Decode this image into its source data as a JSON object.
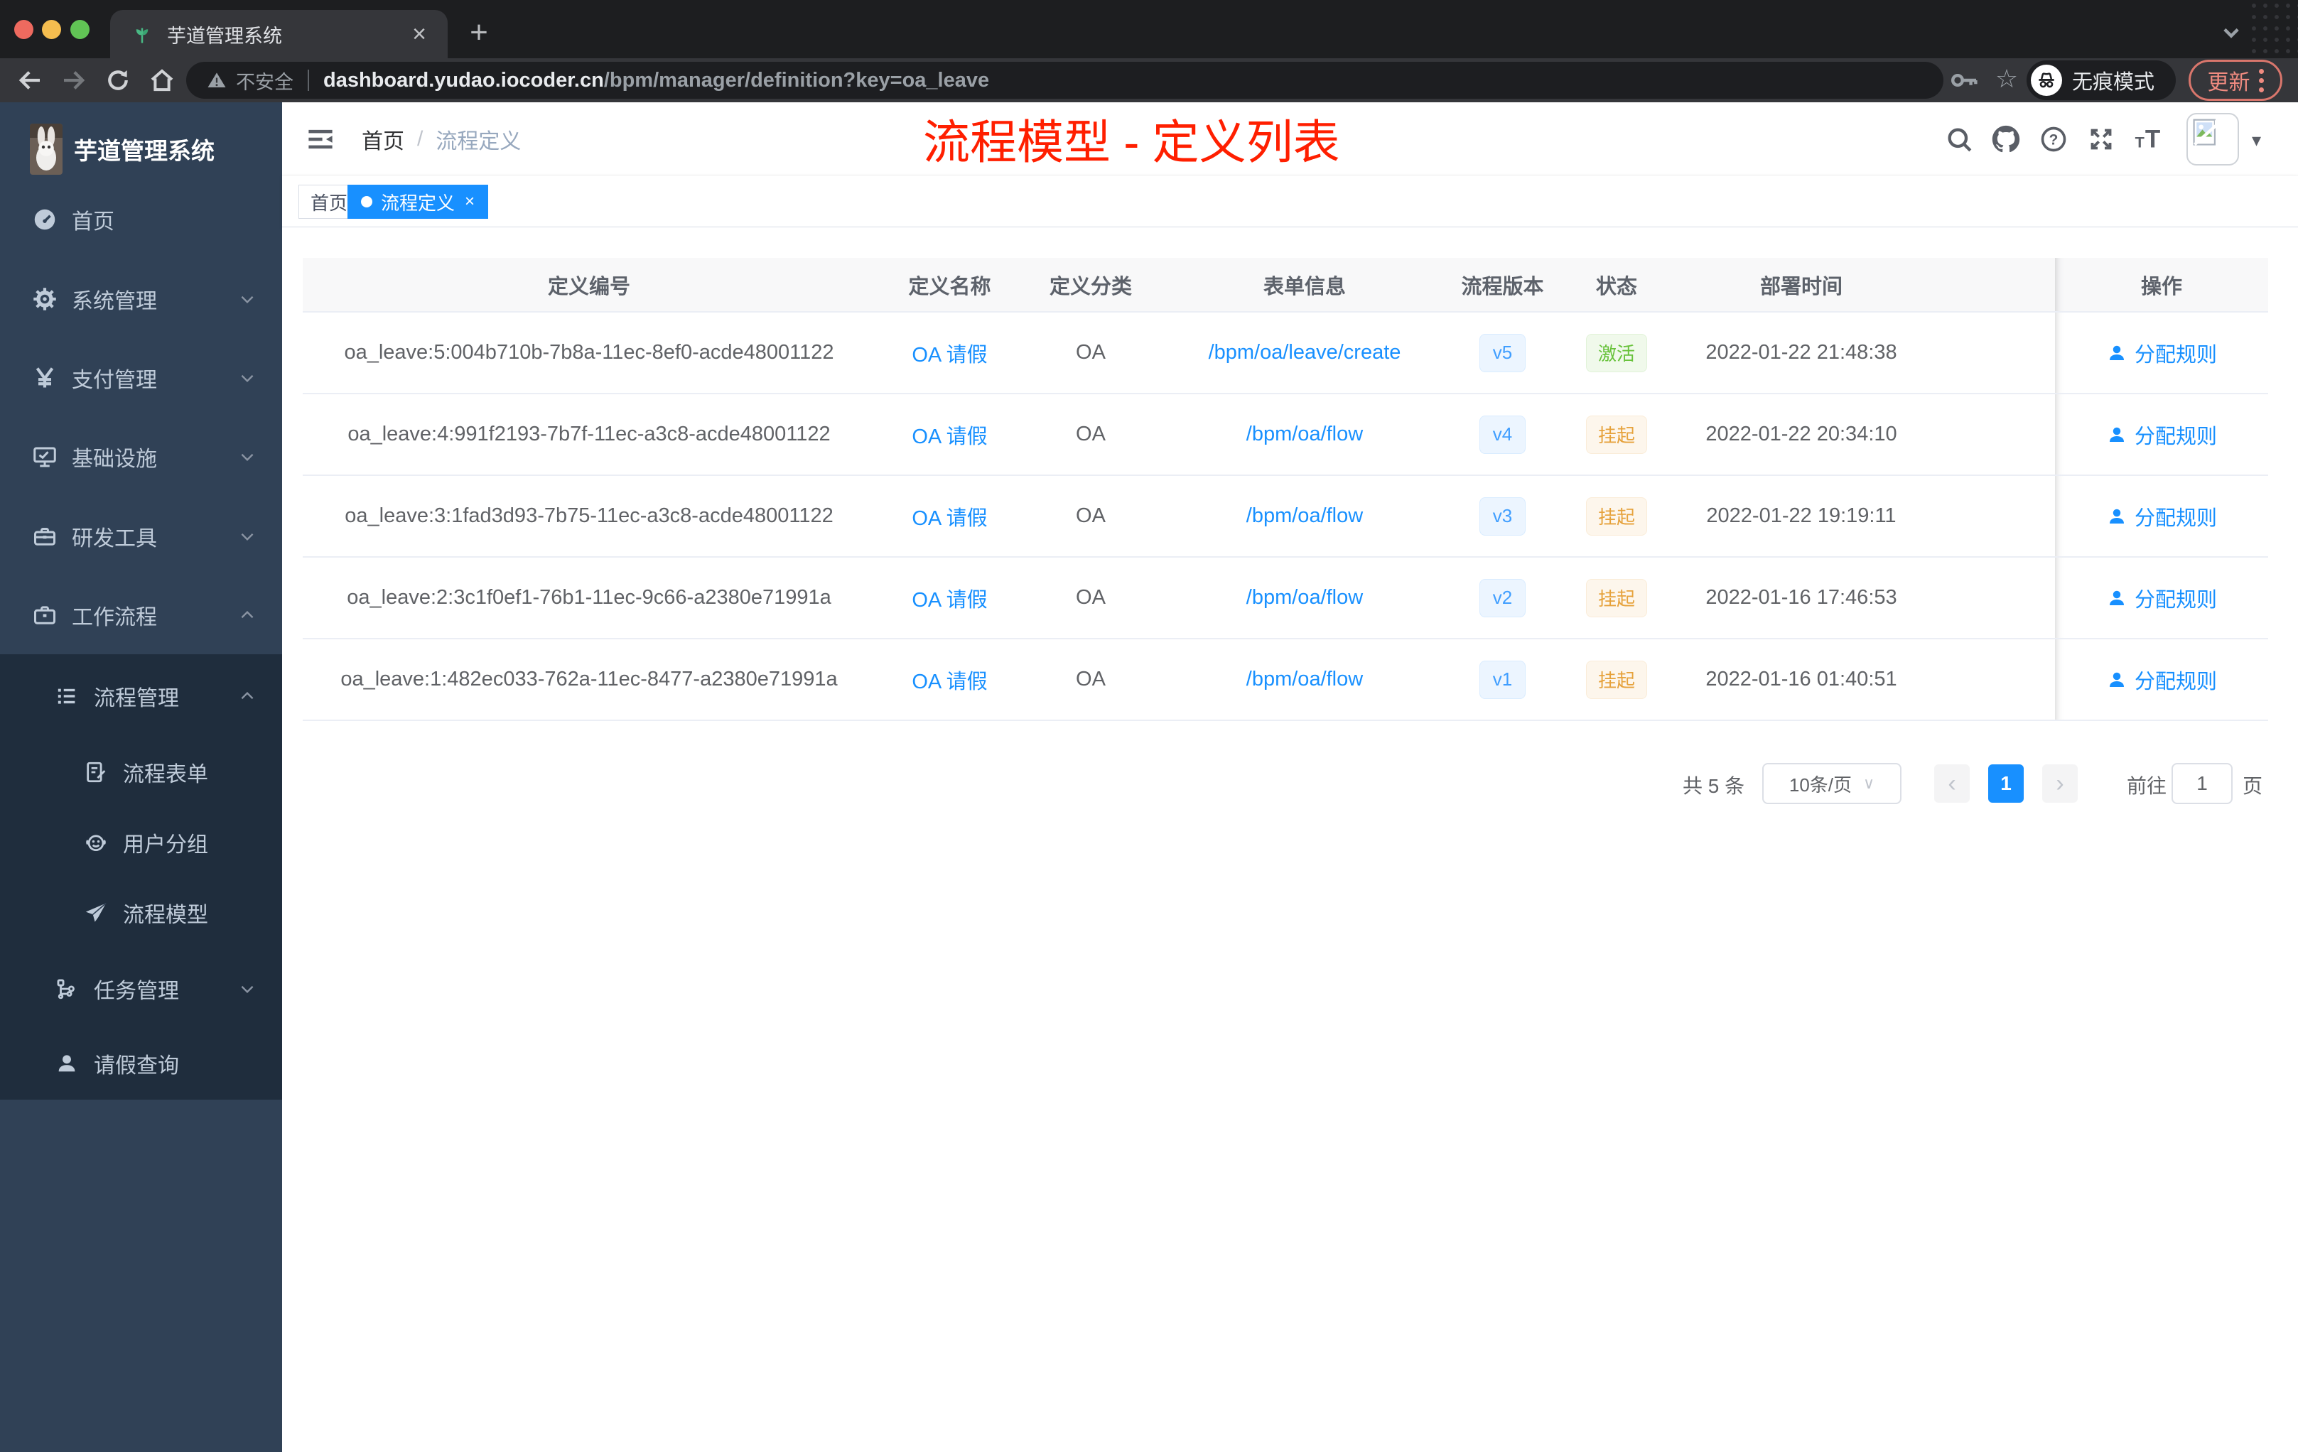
{
  "browser": {
    "tab": {
      "title": "芋道管理系统"
    },
    "address": {
      "security": "不安全",
      "domain": "dashboard.yudao.iocoder.cn",
      "path": "/bpm/manager/definition?key=oa_leave"
    },
    "incognito_label": "无痕模式",
    "update_label": "更新"
  },
  "glyphs": {
    "close": "×",
    "plus": "+",
    "slash": "/",
    "star": "☆",
    "caret_down": "▾",
    "prev": "‹",
    "next": "›",
    "select_caret": "∨"
  },
  "sidebar": {
    "logo_title": "芋道管理系统",
    "items": [
      {
        "label": "首页",
        "icon": "dashboard-icon",
        "level": 1
      },
      {
        "label": "系统管理",
        "icon": "gear-icon",
        "level": 1,
        "expanded": false
      },
      {
        "label": "支付管理",
        "icon": "yen-icon",
        "level": 1,
        "expanded": false
      },
      {
        "label": "基础设施",
        "icon": "monitor-icon",
        "level": 1,
        "expanded": false
      },
      {
        "label": "研发工具",
        "icon": "toolbox-icon",
        "level": 1,
        "expanded": false
      },
      {
        "label": "工作流程",
        "icon": "briefcase-icon",
        "level": 1,
        "expanded": true
      },
      {
        "label": "流程管理",
        "icon": "list-icon",
        "level": 2,
        "expanded": true
      },
      {
        "label": "流程表单",
        "icon": "form-icon",
        "level": 3
      },
      {
        "label": "用户分组",
        "icon": "group-icon",
        "level": 3
      },
      {
        "label": "流程模型",
        "icon": "plane-icon",
        "level": 3
      },
      {
        "label": "任务管理",
        "icon": "tasks-icon",
        "level": 2,
        "expanded": false
      },
      {
        "label": "请假查询",
        "icon": "user-icon",
        "level": 2
      }
    ]
  },
  "header": {
    "breadcrumb": [
      "首页",
      "流程定义"
    ],
    "overlay_title": "流程模型 - 定义列表"
  },
  "tags": [
    {
      "label": "首页",
      "active": false
    },
    {
      "label": "流程定义",
      "active": true,
      "closable": true
    }
  ],
  "table": {
    "columns": [
      "定义编号",
      "定义名称",
      "定义分类",
      "表单信息",
      "流程版本",
      "状态",
      "部署时间",
      "操作"
    ],
    "rows": [
      {
        "id": "oa_leave:5:004b710b-7b8a-11ec-8ef0-acde48001122",
        "name": "OA 请假",
        "category": "OA",
        "form": "/bpm/oa/leave/create",
        "version": "v5",
        "status": "激活",
        "status_type": "success",
        "deployed_at": "2022-01-22 21:48:38",
        "action": "分配规则"
      },
      {
        "id": "oa_leave:4:991f2193-7b7f-11ec-a3c8-acde48001122",
        "name": "OA 请假",
        "category": "OA",
        "form": "/bpm/oa/flow",
        "version": "v4",
        "status": "挂起",
        "status_type": "warning",
        "deployed_at": "2022-01-22 20:34:10",
        "action": "分配规则"
      },
      {
        "id": "oa_leave:3:1fad3d93-7b75-11ec-a3c8-acde48001122",
        "name": "OA 请假",
        "category": "OA",
        "form": "/bpm/oa/flow",
        "version": "v3",
        "status": "挂起",
        "status_type": "warning",
        "deployed_at": "2022-01-22 19:19:11",
        "action": "分配规则"
      },
      {
        "id": "oa_leave:2:3c1f0ef1-76b1-11ec-9c66-a2380e71991a",
        "name": "OA 请假",
        "category": "OA",
        "form": "/bpm/oa/flow",
        "version": "v2",
        "status": "挂起",
        "status_type": "warning",
        "deployed_at": "2022-01-16 17:46:53",
        "action": "分配规则"
      },
      {
        "id": "oa_leave:1:482ec033-762a-11ec-8477-a2380e71991a",
        "name": "OA 请假",
        "category": "OA",
        "form": "/bpm/oa/flow",
        "version": "v1",
        "status": "挂起",
        "status_type": "warning",
        "deployed_at": "2022-01-16 01:40:51",
        "action": "分配规则"
      }
    ]
  },
  "pagination": {
    "total": "共 5 条",
    "page_size": "10条/页",
    "current": "1",
    "goto_label": "前往",
    "goto_value": "1",
    "unit": "页"
  },
  "colors": {
    "primary": "#1890ff",
    "element_blue": "#409eff",
    "success": "#67c23a",
    "warning": "#e6a23c",
    "sidebar_bg": "#304156",
    "submenu_bg": "#1f2d3d",
    "annotation_red": "#ff1f00"
  }
}
